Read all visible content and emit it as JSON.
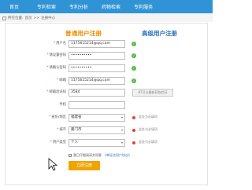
{
  "nav": {
    "items": [
      "首页",
      "专利检索",
      "专利分析",
      "药物检索",
      "专利服务"
    ]
  },
  "breadcrumb": {
    "prefix": "所在位置:",
    "home": "首页",
    "sep": ">>",
    "current": "注册中心"
  },
  "titles": {
    "normal": "普通用户注册",
    "advanced": "高级用户注册"
  },
  "fields": {
    "username": {
      "label": "用户名",
      "value": "1175615214@qq.com"
    },
    "password": {
      "label": "请设置密码",
      "value": "••••••••••"
    },
    "password_confirm": {
      "label": "请确认密码",
      "value": "••••••••••"
    },
    "email": {
      "label": "邮箱",
      "value": "1175615214@qq.com"
    },
    "email_code": {
      "label": "邮箱验证码",
      "value": "3584",
      "button": "87可以重新获取验证"
    },
    "phone": {
      "label": "手机",
      "value": ""
    },
    "province": {
      "label": "省份/地区",
      "value": "福建省",
      "note": "此处为必填项"
    },
    "city": {
      "label": "城市",
      "value": "厦门市",
      "note": "此处为必填项"
    },
    "user_type": {
      "label": "用户类型",
      "value": "个人",
      "note": "此处为必填项"
    }
  },
  "agreement": {
    "text": "我已仔细阅读并同意",
    "link": "《单证信用户协议》"
  },
  "submit_label": "立即注册",
  "colors": {
    "nav": "#2f93d6",
    "title_normal": "#f08c00",
    "title_advanced": "#2a6fba",
    "ok": "#58b947",
    "submit": "#f0a400"
  }
}
